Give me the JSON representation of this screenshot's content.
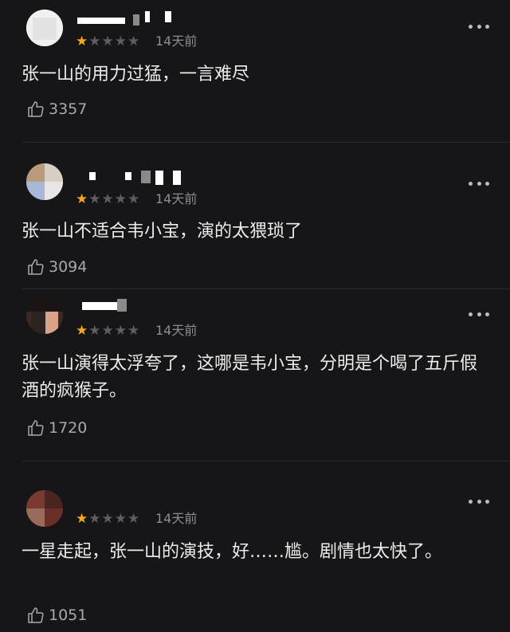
{
  "comments": [
    {
      "rating": 1,
      "time": "14天前",
      "text": "张一山的用力过猛，一言难尽",
      "likes": "3357"
    },
    {
      "rating": 1,
      "time": "14天前",
      "text": "张一山不适合韦小宝，演的太猥琐了",
      "likes": "3094"
    },
    {
      "rating": 1,
      "time": "14天前",
      "text": "张一山演得太浮夸了，这哪是韦小宝，分明是个喝了五斤假酒的疯猴子。",
      "likes": "1720"
    },
    {
      "rating": 1,
      "time": "14天前",
      "text": "一星走起，张一山的演技，好……尴。剧情也太快了。",
      "likes": "1051"
    }
  ],
  "colors": {
    "star_on": "#f5a623",
    "star_off": "#5e5e60",
    "background": "#161618"
  },
  "icons": {
    "more": "more-dots-icon",
    "like": "thumbs-up-icon",
    "star": "star-icon"
  }
}
